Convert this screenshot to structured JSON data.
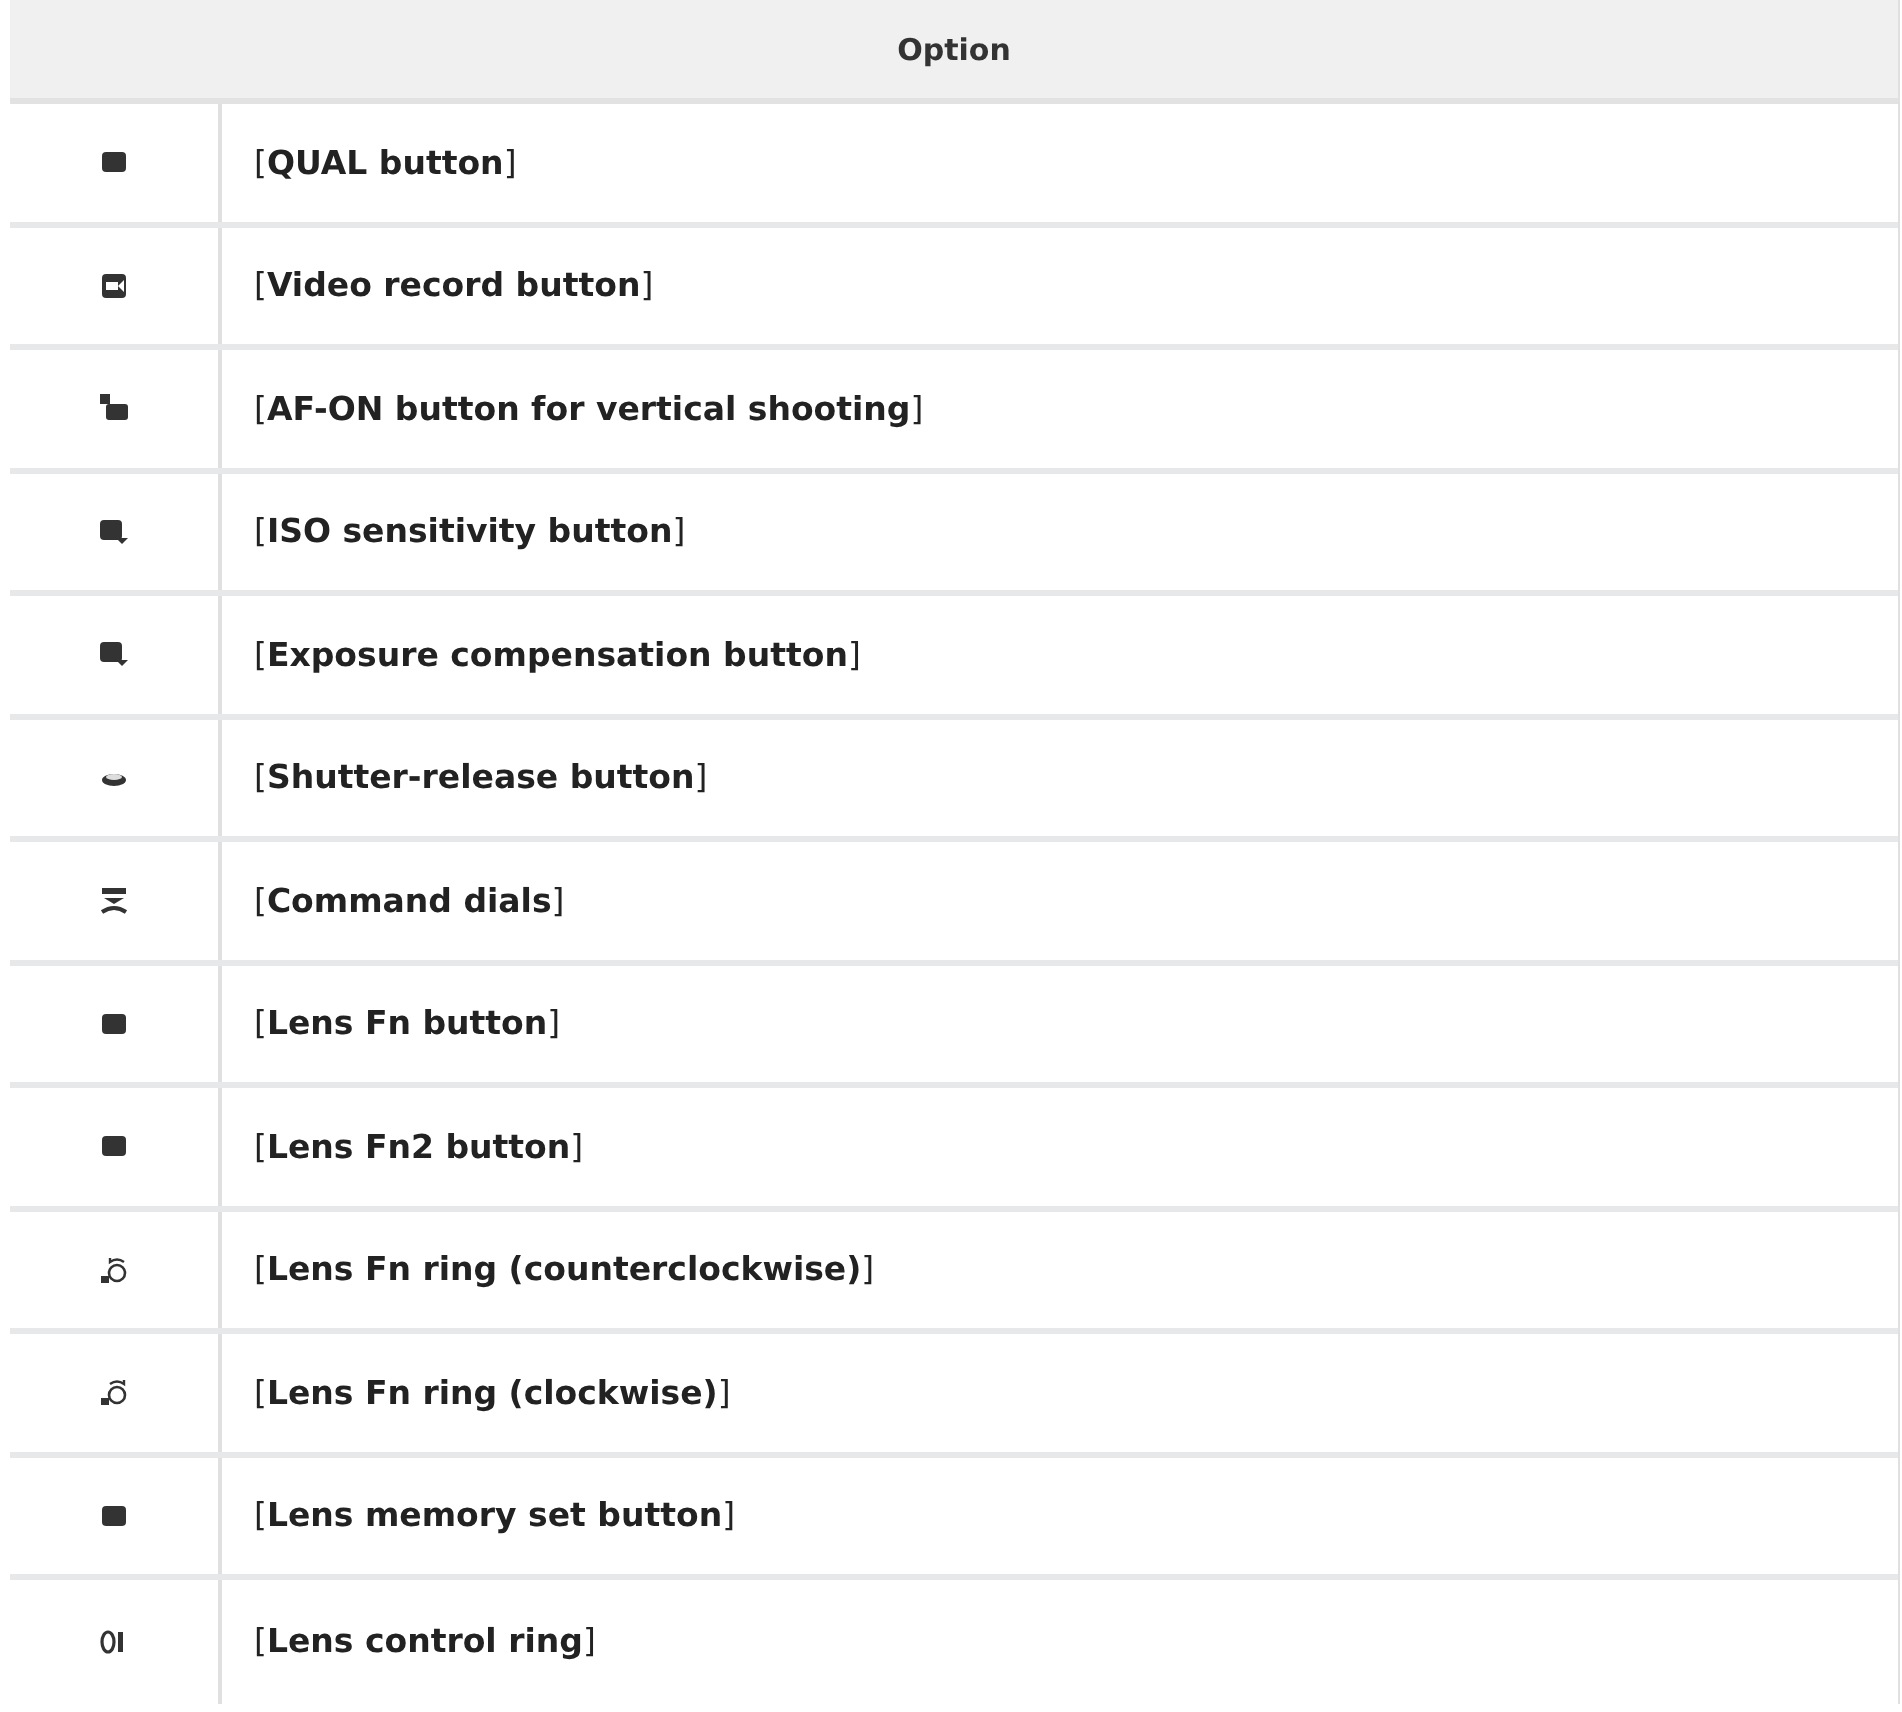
{
  "table": {
    "header": "Option",
    "rows": [
      {
        "kind": "badge",
        "option": "[**QUAL button**]"
      },
      {
        "kind": "video",
        "option": "[**Video record button**]"
      },
      {
        "kind": "afon",
        "option": "[**AF-ON button for vertical shooting**]"
      },
      {
        "kind": "iso",
        "option": "[**ISO sensitivity button**]"
      },
      {
        "kind": "exposure",
        "option": "[**Exposure compensation button**]"
      },
      {
        "kind": "shutter",
        "option": "[**Shutter-release button**]"
      },
      {
        "kind": "dials",
        "option": "[**Command dials**]"
      },
      {
        "kind": "badge",
        "option": "[**Lens Fn button**]"
      },
      {
        "kind": "badge",
        "option": "[**Lens Fn2 button**]"
      },
      {
        "kind": "ringccw",
        "option": "[**Lens Fn ring (counterclockwise)**]"
      },
      {
        "kind": "ringcw",
        "option": "[**Lens Fn ring (clockwise)**]"
      },
      {
        "kind": "badge",
        "option": "[**Lens memory set button**]"
      },
      {
        "kind": "ring",
        "option": "[**Lens control ring**]"
      }
    ]
  }
}
